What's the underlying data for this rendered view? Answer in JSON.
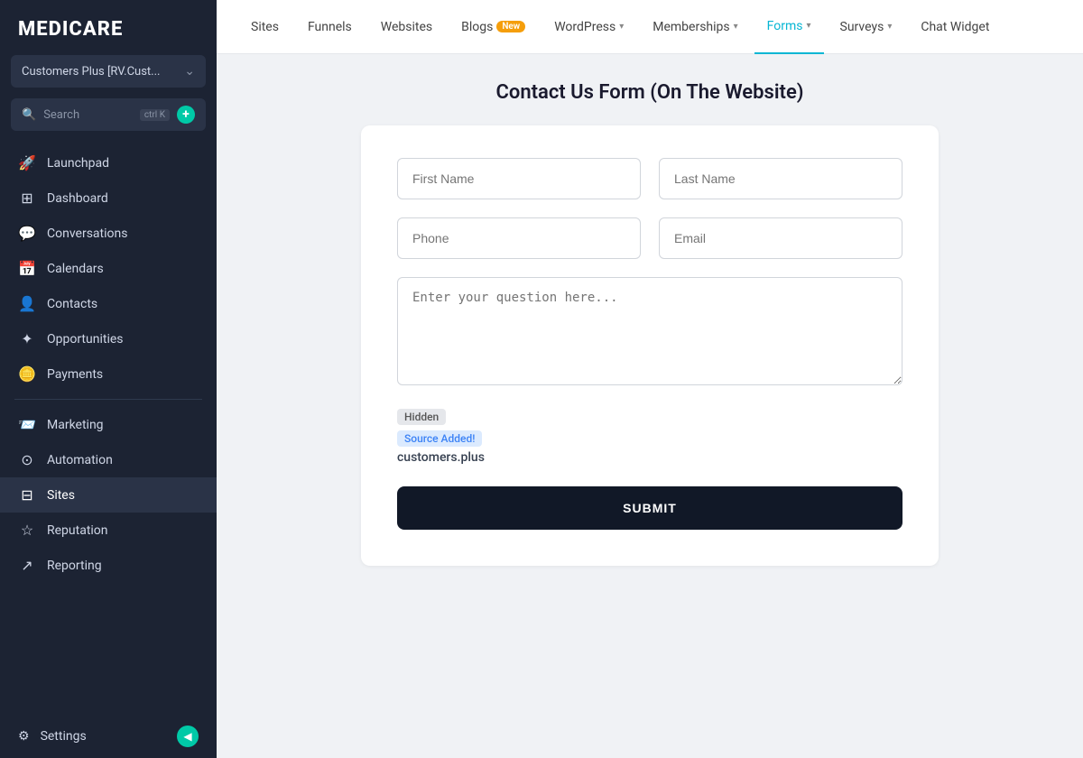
{
  "app": {
    "name": "MEDICARE"
  },
  "sidebar": {
    "account": {
      "label": "Customers Plus [RV.Cust..."
    },
    "search": {
      "placeholder": "Search",
      "shortcut": "ctrl K"
    },
    "nav_items": [
      {
        "id": "launchpad",
        "label": "Launchpad",
        "icon": "🚀"
      },
      {
        "id": "dashboard",
        "label": "Dashboard",
        "icon": "⊞"
      },
      {
        "id": "conversations",
        "label": "Conversations",
        "icon": "💬"
      },
      {
        "id": "calendars",
        "label": "Calendars",
        "icon": "📅"
      },
      {
        "id": "contacts",
        "label": "Contacts",
        "icon": "👤"
      },
      {
        "id": "opportunities",
        "label": "Opportunities",
        "icon": "✦"
      },
      {
        "id": "payments",
        "label": "Payments",
        "icon": "🪙"
      },
      {
        "id": "marketing",
        "label": "Marketing",
        "icon": "📨"
      },
      {
        "id": "automation",
        "label": "Automation",
        "icon": "⊙"
      },
      {
        "id": "sites",
        "label": "Sites",
        "icon": "⊟",
        "active": true
      },
      {
        "id": "reputation",
        "label": "Reputation",
        "icon": "☆"
      },
      {
        "id": "reporting",
        "label": "Reporting",
        "icon": "↗"
      }
    ],
    "settings": {
      "label": "Settings"
    }
  },
  "topnav": {
    "items": [
      {
        "id": "sites",
        "label": "Sites",
        "active": false
      },
      {
        "id": "funnels",
        "label": "Funnels",
        "active": false
      },
      {
        "id": "websites",
        "label": "Websites",
        "active": false
      },
      {
        "id": "blogs",
        "label": "Blogs",
        "badge": "New",
        "active": false
      },
      {
        "id": "wordpress",
        "label": "WordPress",
        "chevron": true,
        "active": false
      },
      {
        "id": "memberships",
        "label": "Memberships",
        "chevron": true,
        "active": false
      },
      {
        "id": "forms",
        "label": "Forms",
        "chevron": true,
        "active": true
      },
      {
        "id": "surveys",
        "label": "Surveys",
        "chevron": true,
        "active": false
      },
      {
        "id": "chat_widget",
        "label": "Chat Widget",
        "active": false
      }
    ]
  },
  "page": {
    "title": "Contact Us Form (On The Website)"
  },
  "form": {
    "first_name_placeholder": "First Name",
    "last_name_placeholder": "Last Name",
    "phone_placeholder": "Phone",
    "email_placeholder": "Email",
    "question_placeholder": "Enter your question here...",
    "hidden_badge": "Hidden",
    "source_badge": "Source Added!",
    "hidden_value": "customers.plus",
    "submit_label": "SUBMIT"
  }
}
